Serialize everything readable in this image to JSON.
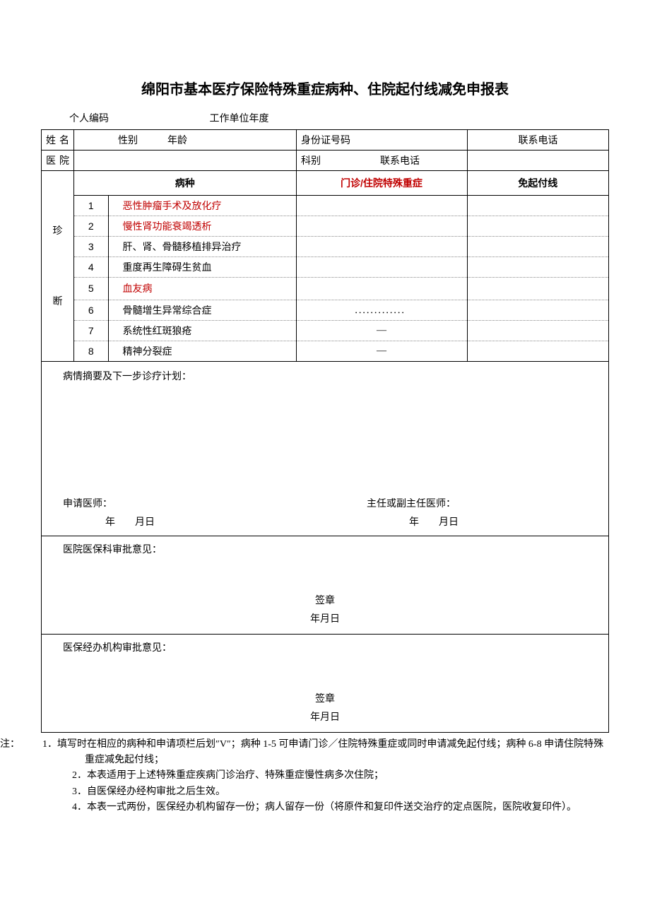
{
  "title": "绵阳市基本医疗保险特殊重症病种、住院起付线减免申报表",
  "header": {
    "personal_code_label": "个人编码",
    "work_unit_year_label": "工作单位年度"
  },
  "row1": {
    "name_label": "姓名",
    "gender_label": "性别",
    "age_label": "年龄",
    "id_label": "身份证号码",
    "phone_label": "联系电话"
  },
  "row2": {
    "hospital_label": "医院",
    "dept_label": "科别",
    "dept_phone_label": "联系电话"
  },
  "diagnosis_label_1": "珍",
  "diagnosis_label_2": "断",
  "diag_header": {
    "disease_label": "病种",
    "col_a": "门诊/住院特殊重症",
    "col_b": "免起付线"
  },
  "diseases": [
    {
      "n": "1",
      "name": "恶性肿瘤手术及放化疗",
      "a": "",
      "b": "",
      "red": true
    },
    {
      "n": "2",
      "name": "慢性肾功能衰竭透析",
      "a": "",
      "b": "",
      "red": true
    },
    {
      "n": "3",
      "name": "肝、肾、骨髓移植排异治疗",
      "a": "",
      "b": "",
      "red": false
    },
    {
      "n": "4",
      "name": "重度再生障碍生贫血",
      "a": "",
      "b": "",
      "red": false
    },
    {
      "n": "5",
      "name": "血友病",
      "a": "",
      "b": "",
      "red": true
    },
    {
      "n": "6",
      "name": "骨髓增生异常综合症",
      "a": "．．．．．．．．．．．．．",
      "b": "",
      "red": false
    },
    {
      "n": "7",
      "name": "系统性红斑狼疮",
      "a": "—",
      "b": "",
      "red": false
    },
    {
      "n": "8",
      "name": "精神分裂症",
      "a": "—",
      "b": "",
      "red": false
    }
  ],
  "summary": {
    "label": "病情摘要及下一步诊疗计划：",
    "doctor_label": "申请医师：",
    "chief_label": "主任或副主任医师：",
    "date_left": "年  月日",
    "date_right": "年  月日"
  },
  "approval1": {
    "label": "医院医保科审批意见：",
    "seal": "签章",
    "date": "年月日"
  },
  "approval2": {
    "label": "医保经办机构审批意见：",
    "seal": "签章",
    "date": "年月日"
  },
  "notes": {
    "head": "注：",
    "items": [
      "1．填写时在相应的病种和申请项栏后划″V″；病种 1-5 可申请门诊／住院特殊重症或同时申请减免起付线；病种 6-8 申请住院特殊重症减免起付线；",
      "2．本表适用于上述特殊重症疾病门诊治疗、特殊重症慢性病多次住院；",
      "3．自医保经办经构审批之后生效。",
      "4．本表一式两份，医保经办机构留存一份；病人留存一份（将原件和复印件送交治疗的定点医院，医院收复印件）。"
    ]
  }
}
